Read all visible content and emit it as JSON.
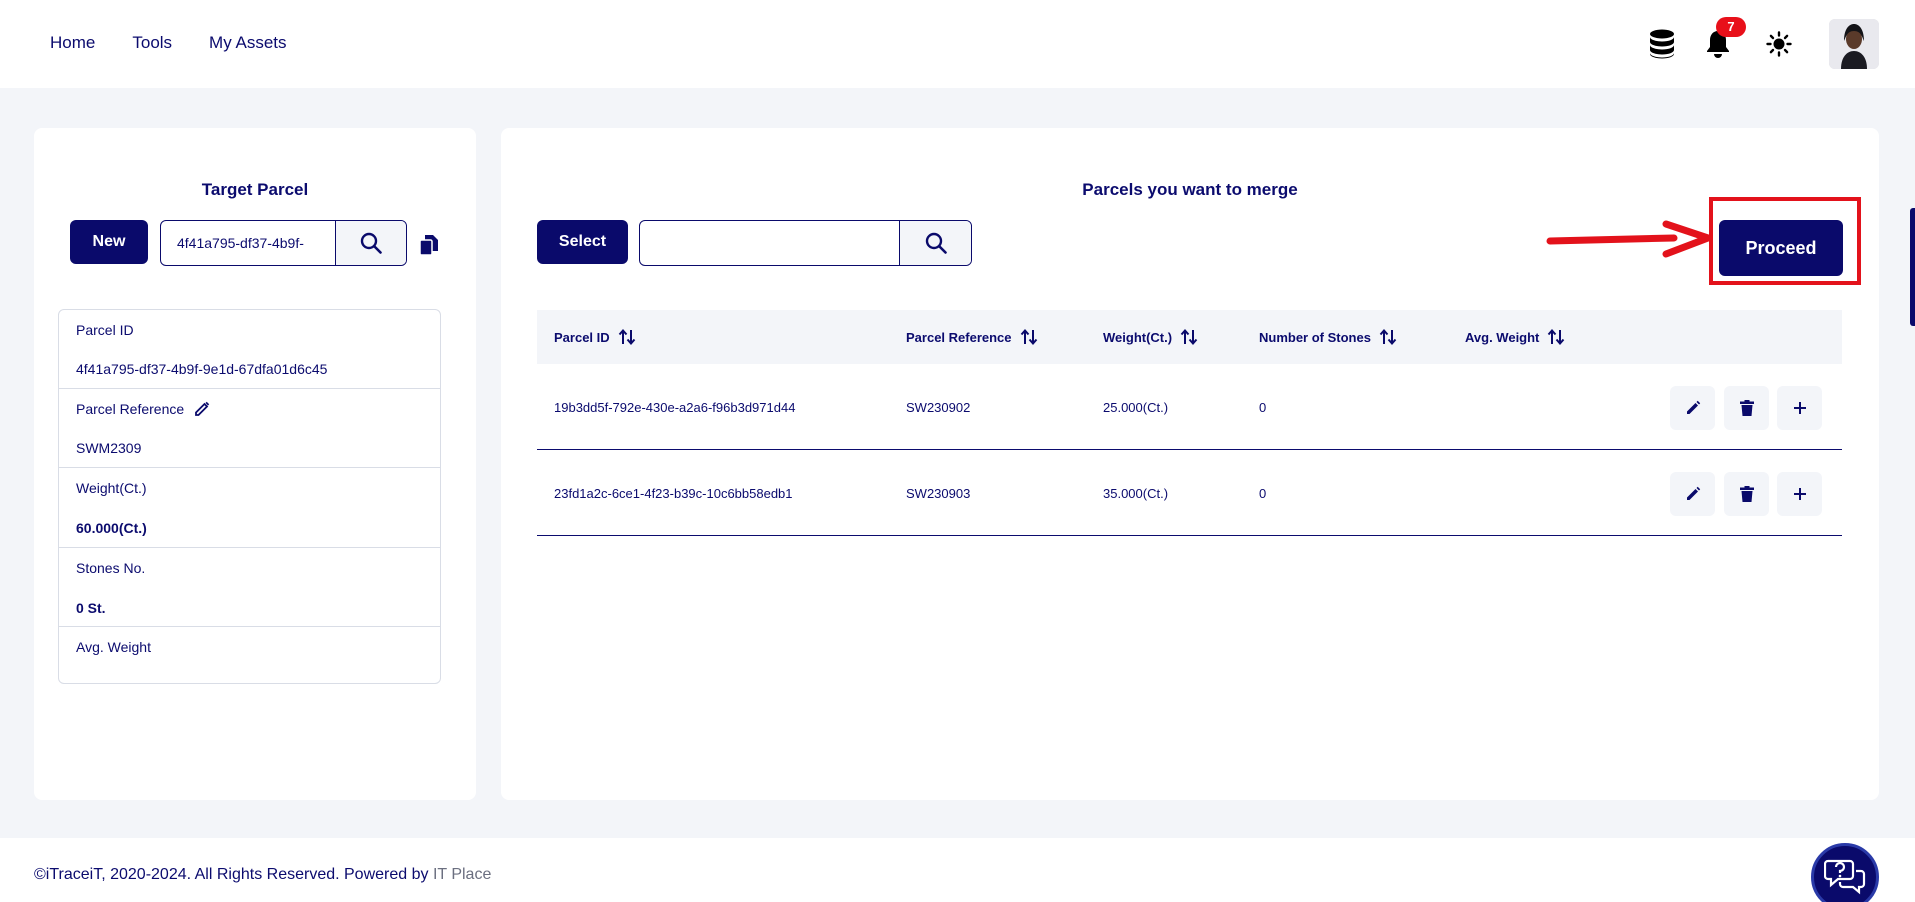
{
  "nav": {
    "items": [
      "Home",
      "Tools",
      "My Assets"
    ]
  },
  "header": {
    "notification_count": "7",
    "icons": [
      "database-icon",
      "bell-icon",
      "sun-icon",
      "avatar"
    ]
  },
  "target_parcel": {
    "title": "Target Parcel",
    "new_label": "New",
    "search_value": "4f41a795-df37-4b9f-",
    "parcel_id_label": "Parcel ID",
    "parcel_id_value": "4f41a795-df37-4b9f-9e1d-67dfa01d6c45",
    "parcel_ref_label": "Parcel Reference",
    "parcel_ref_value": "SWM2309",
    "weight_label": "Weight(Ct.)",
    "weight_value": "60.000(Ct.)",
    "stones_label": "Stones No.",
    "stones_value": "0 St.",
    "avg_weight_label": "Avg. Weight",
    "avg_weight_value": ""
  },
  "merge": {
    "title": "Parcels you want to merge",
    "select_label": "Select",
    "search_value": "",
    "proceed_label": "Proceed",
    "columns": [
      "Parcel ID",
      "Parcel Reference",
      "Weight(Ct.)",
      "Number of Stones",
      "Avg. Weight"
    ],
    "rows": [
      {
        "id": "19b3dd5f-792e-430e-a2a6-f96b3d971d44",
        "ref": "SW230902",
        "weight": "25.000(Ct.)",
        "stones": "0",
        "avg": ""
      },
      {
        "id": "23fd1a2c-6ce1-4f23-b39c-10c6bb58edb1",
        "ref": "SW230903",
        "weight": "35.000(Ct.)",
        "stones": "0",
        "avg": ""
      }
    ]
  },
  "footer": {
    "text": "©iTraceiT, 2020-2024. All Rights Reserved. Powered by ",
    "link": "IT Place"
  },
  "colors": {
    "primary": "#0a0a6b",
    "accent": "#e3121b",
    "background": "#f3f5f9"
  }
}
